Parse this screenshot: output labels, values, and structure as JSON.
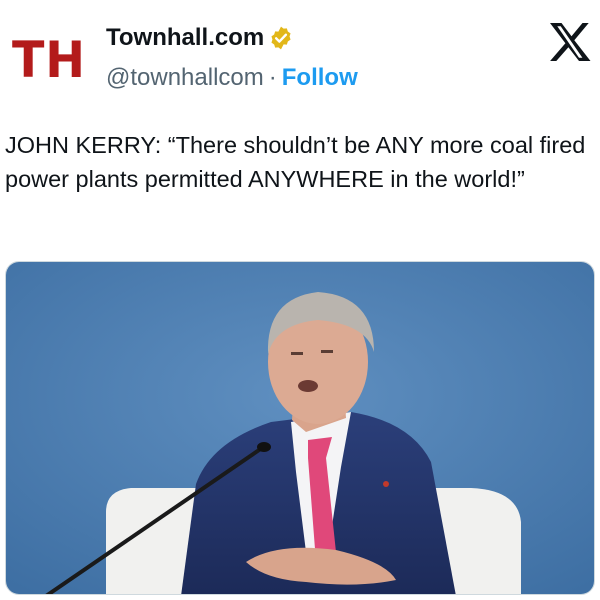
{
  "account": {
    "avatar_text": "TH",
    "display_name": "Townhall.com",
    "handle": "@townhallcom",
    "separator": "·",
    "follow_label": "Follow"
  },
  "tweet": {
    "text": "JOHN KERRY: “There shouldn’t be ANY more coal fired power plants permitted ANYWHERE in the world!”"
  },
  "icons": {
    "verified": "verified-gold-badge-icon",
    "platform": "x-logo-icon"
  },
  "colors": {
    "brand_red": "#b31b1b",
    "follow_blue": "#1d9bf0",
    "badge_gold": "#e2b719",
    "text": "#0f1419",
    "secondary": "#536471"
  }
}
